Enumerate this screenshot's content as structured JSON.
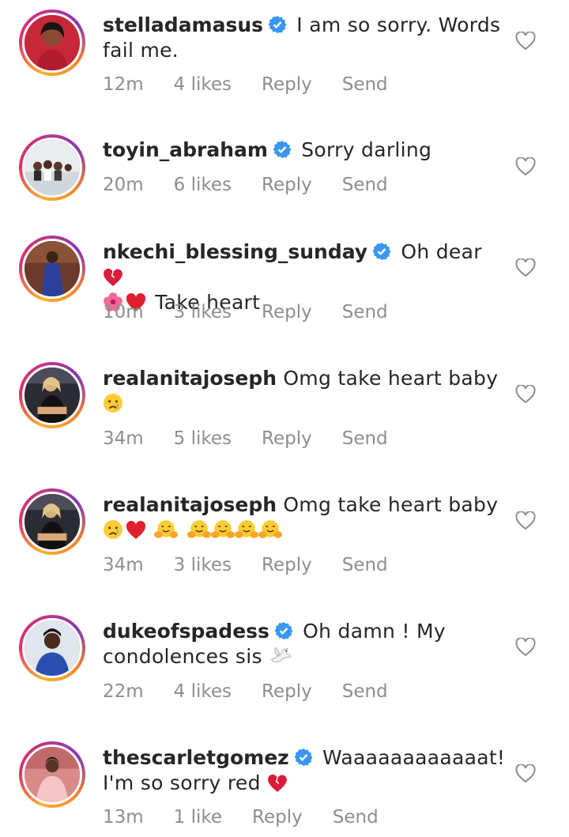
{
  "comments": [
    {
      "username": "stelladamasus",
      "verified": true,
      "text_line1": "I am so sorry. Words",
      "text_line2": "fail me.",
      "time": "12m",
      "likes": "4 likes",
      "reply": "Reply",
      "send": "Send"
    },
    {
      "username": "toyin_abraham",
      "verified": true,
      "text_line1": "Sorry darling",
      "time": "20m",
      "likes": "6 likes",
      "reply": "Reply",
      "send": "Send"
    },
    {
      "username": "nkechi_blessing_sunday",
      "verified": true,
      "text_line1": "Oh dear",
      "text_line2": "Take heart",
      "emojis_line1": [
        "broken-heart-emoji"
      ],
      "emojis_line2_prefix": [
        "hibiscus-emoji",
        "red-heart-emoji"
      ],
      "time": "10m",
      "likes": "3 likes",
      "reply": "Reply",
      "send": "Send"
    },
    {
      "username": "realanitajoseph",
      "verified": false,
      "text_line1": "Omg take heart baby",
      "emojis_line2": [
        "crying-face-emoji"
      ],
      "time": "34m",
      "likes": "5 likes",
      "reply": "Reply",
      "send": "Send"
    },
    {
      "username": "realanitajoseph",
      "verified": false,
      "text_line1": "Omg take heart baby",
      "emojis_line2": [
        "crying-face-emoji",
        "red-heart-emoji",
        "hugging-face-emoji",
        "hugging-face-emoji",
        "hugging-face-emoji",
        "hugging-face-emoji",
        "hugging-face-emoji"
      ],
      "time": "34m",
      "likes": "3 likes",
      "reply": "Reply",
      "send": "Send"
    },
    {
      "username": "dukeofspadess",
      "verified": true,
      "text_line1": "Oh damn ! My",
      "text_line2": "condolences sis",
      "emojis_line2": [
        "dove-emoji"
      ],
      "time": "22m",
      "likes": "4 likes",
      "reply": "Reply",
      "send": "Send"
    },
    {
      "username": "thescarletgomez",
      "verified": true,
      "text_line1": "Waaaaaaaaaaaat!",
      "text_line2": "I'm so sorry red",
      "emojis_line2": [
        "broken-heart-emoji"
      ],
      "time": "13m",
      "likes": "1 like",
      "reply": "Reply",
      "send": "Send"
    }
  ],
  "colors": {
    "verified": "#3897f0",
    "meta": "#8e8e8e",
    "text": "#262626",
    "heart_outline": "#8e8e8e"
  }
}
